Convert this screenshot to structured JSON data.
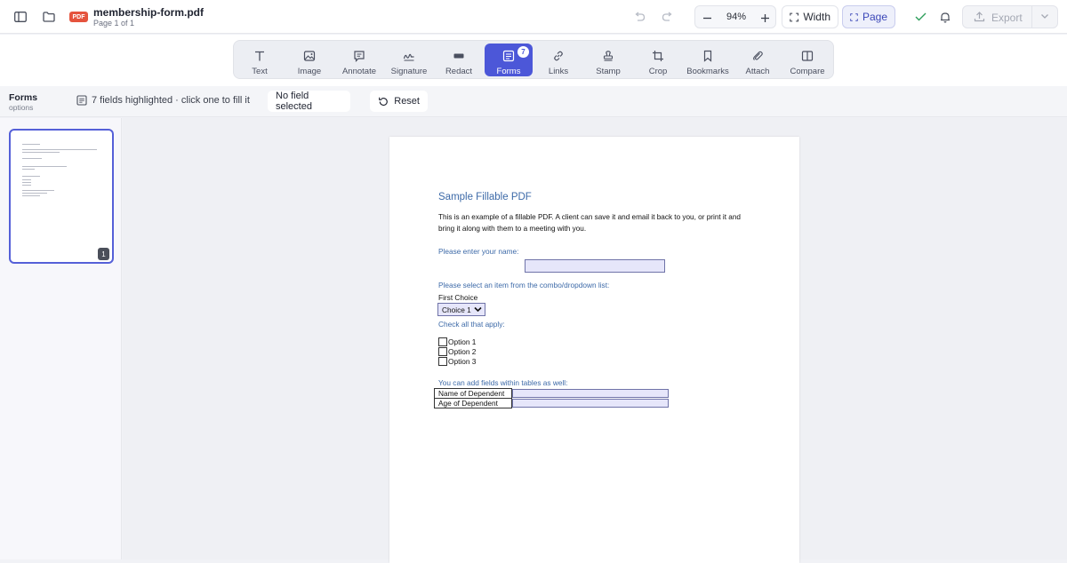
{
  "header": {
    "file_type_badge": "PDF",
    "file_name": "membership-form.pdf",
    "page_info": "Page 1 of 1",
    "zoom_value": "94%",
    "width_label": "Width",
    "page_label": "Page",
    "export_label": "Export"
  },
  "toolbar": {
    "tools": [
      {
        "label": "Text",
        "icon": "text-icon"
      },
      {
        "label": "Image",
        "icon": "image-icon"
      },
      {
        "label": "Annotate",
        "icon": "annotate-icon"
      },
      {
        "label": "Signature",
        "icon": "signature-icon"
      },
      {
        "label": "Redact",
        "icon": "redact-icon"
      },
      {
        "label": "Forms",
        "icon": "forms-icon",
        "badge": "7",
        "active": true
      },
      {
        "label": "Links",
        "icon": "link-icon"
      },
      {
        "label": "Stamp",
        "icon": "stamp-icon"
      },
      {
        "label": "Crop",
        "icon": "crop-icon"
      },
      {
        "label": "Bookmarks",
        "icon": "bookmark-icon"
      },
      {
        "label": "Attach",
        "icon": "paperclip-icon"
      },
      {
        "label": "Compare",
        "icon": "compare-icon"
      }
    ]
  },
  "forms_bar": {
    "title": "Forms",
    "subtitle": "options",
    "info": "7 fields highlighted · click one to fill it",
    "selection_status": "No field selected",
    "reset_label": "Reset"
  },
  "sidebar": {
    "thumbnail_page_number": "1"
  },
  "document": {
    "title": "Sample Fillable PDF",
    "intro": "This is an example of a fillable PDF. A client can save it and email it back to you, or print it and bring it along with them to a meeting with you.",
    "name_prompt": "Please enter your name:",
    "combo_prompt": "Please select an item from the combo/dropdown list:",
    "combo_label": "First Choice",
    "combo_value": "Choice 1",
    "check_prompt": "Check all that apply:",
    "options": [
      "Option 1",
      "Option 2",
      "Option 3"
    ],
    "table_prompt": "You can add  fields within tables as well:",
    "table_rows": [
      "Name of Dependent",
      "Age of Dependent"
    ]
  },
  "colors": {
    "accent": "#4c57d8",
    "field_fill": "#e6e6fa",
    "doc_heading": "#3d6aa8",
    "pdf_badge": "#e5533d",
    "confirm_check": "#2e9e5b"
  }
}
